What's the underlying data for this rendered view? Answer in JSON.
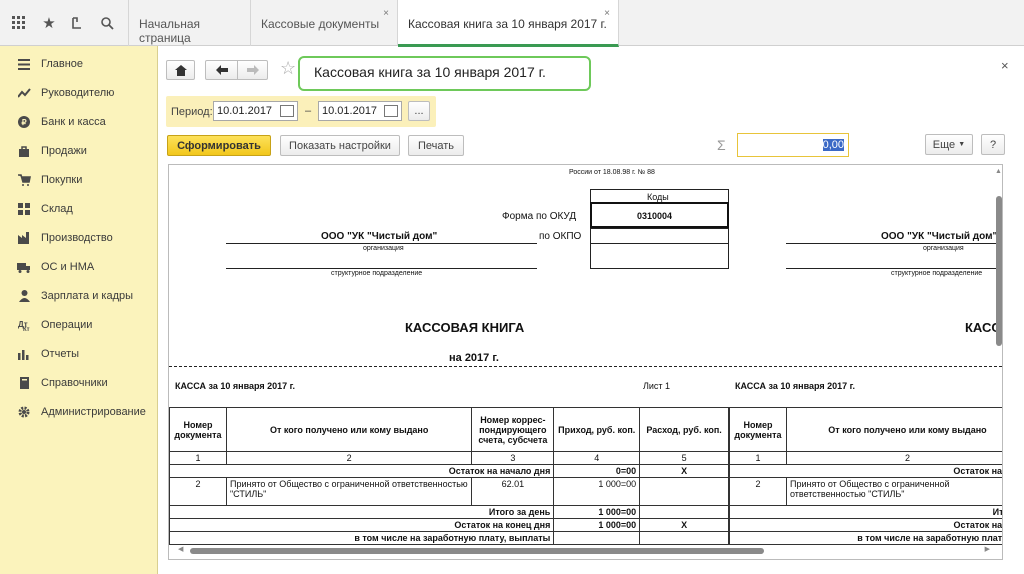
{
  "tabs": [
    {
      "label": "Начальная страница"
    },
    {
      "label": "Кассовые документы",
      "close": "×"
    },
    {
      "label": "Кассовая книга за 10 января 2017 г.",
      "close": "×"
    }
  ],
  "sidebar": {
    "items": [
      {
        "label": "Главное",
        "icon": "menu-icon"
      },
      {
        "label": "Руководителю",
        "icon": "chart-line-icon"
      },
      {
        "label": "Банк и касса",
        "icon": "coin-icon"
      },
      {
        "label": "Продажи",
        "icon": "bag-icon"
      },
      {
        "label": "Покупки",
        "icon": "cart-icon"
      },
      {
        "label": "Склад",
        "icon": "warehouse-icon"
      },
      {
        "label": "Производство",
        "icon": "factory-icon"
      },
      {
        "label": "ОС и НМА",
        "icon": "truck-icon"
      },
      {
        "label": "Зарплата и кадры",
        "icon": "person-icon"
      },
      {
        "label": "Операции",
        "icon": "operations-icon"
      },
      {
        "label": "Отчеты",
        "icon": "bar-chart-icon"
      },
      {
        "label": "Справочники",
        "icon": "book-icon"
      },
      {
        "label": "Администрирование",
        "icon": "gear-icon"
      }
    ]
  },
  "header": {
    "title": "Кассовая книга за 10 января 2017 г.",
    "close": "×"
  },
  "period": {
    "label": "Период:",
    "from": "10.01.2017",
    "dash": "–",
    "to": "10.01.2017",
    "more": "..."
  },
  "toolbar": {
    "generate": "Сформировать",
    "settings": "Показать настройки",
    "print": "Печать",
    "sum_symbol": "Σ",
    "sum_value": "0,00",
    "more": "Еще",
    "help": "?"
  },
  "report": {
    "top_text": "России от 18.08.98 г. № 88",
    "codes_header": "Коды",
    "okud_label": "Форма по ОКУД",
    "okud_value": "0310004",
    "okpo_label": "по ОКПО",
    "org_name": "ООО \"УК \"Чистый дом\"",
    "org_caption": "организация",
    "dept_caption": "структурное подразделение",
    "book_title": "КАССОВАЯ КНИГА",
    "book_title_right": "КАСС",
    "year": "на 2017 г.",
    "kassa": "КАССА за 10 января 2017 г.",
    "sheet": "Лист 1",
    "columns": [
      "Номер документа",
      "От кого получено или кому выдано",
      "Номер коррес-пондирующего счета, субсчета",
      "Приход, руб. коп.",
      "Расход, руб. коп."
    ],
    "col_numbers": [
      "1",
      "2",
      "3",
      "4",
      "5"
    ],
    "opening_label": "Остаток на начало дня",
    "opening_label_right": "Остаток на нача",
    "opening_in": "0=00",
    "opening_out": "Х",
    "row": {
      "num": "2",
      "who": "Принято от Общество с ограниченной ответственностью \"СТИЛЬ\"",
      "acct": "62.01",
      "in": "1 000=00"
    },
    "day_total": "Итого за день",
    "day_total_right": "Итого з",
    "day_total_in": "1 000=00",
    "closing_label": "Остаток на конец  дня",
    "closing_label_right": "Остаток на коне",
    "closing_in": "1 000=00",
    "closing_out": "Х",
    "salary_label": "в том числе на заработную плату, выплаты",
    "salary_label_right": "в том числе на заработную плату, вы"
  }
}
